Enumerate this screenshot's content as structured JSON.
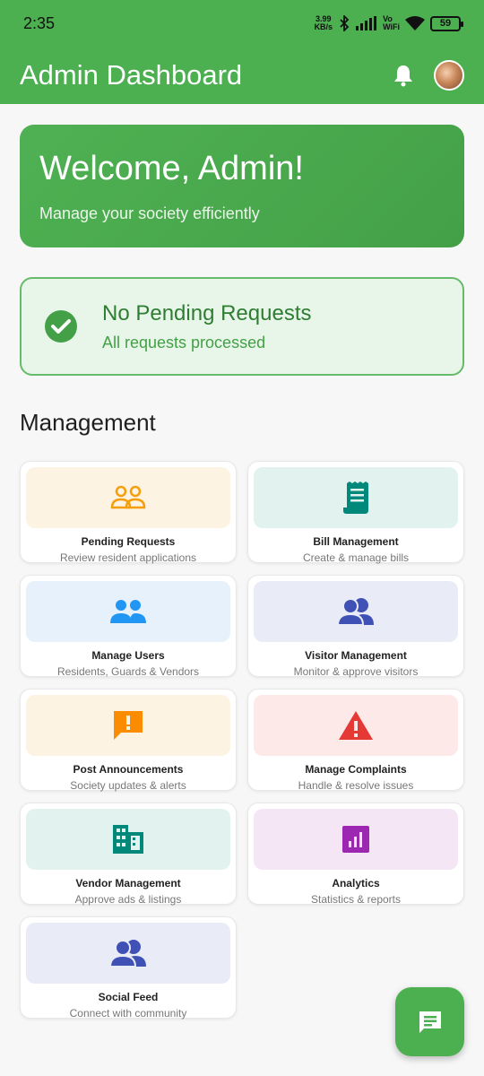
{
  "status_bar": {
    "time": "2:35",
    "net_speed_value": "3.99",
    "net_speed_unit": "KB/s",
    "wifi_label_top": "Vo",
    "wifi_label_bottom": "WiFi",
    "battery": "59"
  },
  "app_bar": {
    "title": "Admin Dashboard",
    "bell_icon": "notifications-icon",
    "avatar": "user-avatar"
  },
  "welcome": {
    "title": "Welcome, Admin!",
    "subtitle": "Manage your society efficiently"
  },
  "pending": {
    "title": "No Pending Requests",
    "subtitle": "All requests processed",
    "icon": "check-circle-icon"
  },
  "section_title": "Management",
  "tiles": [
    {
      "title": "Pending Requests",
      "subtitle": "Review resident applications",
      "icon": "people-outline-icon",
      "bg": "#fdf3e2",
      "color": "#f59e0b"
    },
    {
      "title": "Bill Management",
      "subtitle": "Create & manage bills",
      "icon": "receipt-icon",
      "bg": "#e2f2ef",
      "color": "#00897b"
    },
    {
      "title": "Manage Users",
      "subtitle": "Residents, Guards & Vendors",
      "icon": "people-icon",
      "bg": "#e6f1fc",
      "color": "#2196f3"
    },
    {
      "title": "Visitor Management",
      "subtitle": "Monitor & approve visitors",
      "icon": "group-icon",
      "bg": "#e9ecf6",
      "color": "#3f51b5"
    },
    {
      "title": "Post Announcements",
      "subtitle": "Society updates & alerts",
      "icon": "announcement-icon",
      "bg": "#fdf3e2",
      "color": "#fb8c00"
    },
    {
      "title": "Manage Complaints",
      "subtitle": "Handle & resolve issues",
      "icon": "warning-icon",
      "bg": "#fde9e7",
      "color": "#e53935"
    },
    {
      "title": "Vendor Management",
      "subtitle": "Approve ads & listings",
      "icon": "business-icon",
      "bg": "#e2f2ef",
      "color": "#00897b"
    },
    {
      "title": "Analytics",
      "subtitle": "Statistics & reports",
      "icon": "analytics-icon",
      "bg": "#f5e6f6",
      "color": "#9c27b0"
    },
    {
      "title": "Social Feed",
      "subtitle": "Connect with community",
      "icon": "group-icon",
      "bg": "#e9ecf6",
      "color": "#3f51b5"
    }
  ],
  "fab": {
    "icon": "chat-icon"
  }
}
